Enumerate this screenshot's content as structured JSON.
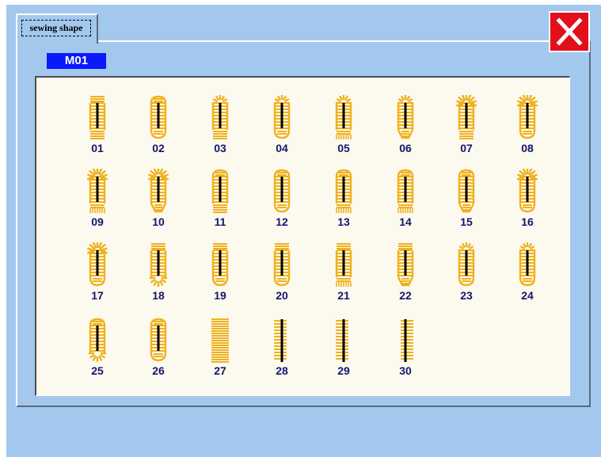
{
  "tab": {
    "label": "sewing shape"
  },
  "mode": {
    "label": "M01"
  },
  "close": {
    "icon": "close-icon",
    "color": "#e3101b"
  },
  "colors": {
    "stitch": "#f0b11c",
    "cut": "#000000",
    "number": "#14166e",
    "badge": "#0b19ff"
  },
  "shapes": [
    {
      "num": "01",
      "top": "square",
      "bottom": "square"
    },
    {
      "num": "02",
      "top": "round",
      "bottom": "round"
    },
    {
      "num": "03",
      "top": "eyelet",
      "bottom": "square"
    },
    {
      "num": "04",
      "top": "eyelet",
      "bottom": "round"
    },
    {
      "num": "05",
      "top": "eyelet",
      "bottom": "bartack"
    },
    {
      "num": "06",
      "top": "eyelet",
      "bottom": "taper"
    },
    {
      "num": "07",
      "top": "eyelet-big",
      "bottom": "square"
    },
    {
      "num": "08",
      "top": "eyelet-big",
      "bottom": "round"
    },
    {
      "num": "09",
      "top": "eyelet-big",
      "bottom": "bartack"
    },
    {
      "num": "10",
      "top": "eyelet-big",
      "bottom": "taper"
    },
    {
      "num": "11",
      "top": "round",
      "bottom": "square"
    },
    {
      "num": "12",
      "top": "round",
      "bottom": "round"
    },
    {
      "num": "13",
      "top": "round",
      "bottom": "bartack"
    },
    {
      "num": "14",
      "top": "round",
      "bottom": "bartack"
    },
    {
      "num": "15",
      "top": "round",
      "bottom": "taper"
    },
    {
      "num": "16",
      "top": "eyelet-big",
      "bottom": "round"
    },
    {
      "num": "17",
      "top": "eyelet-big",
      "bottom": "round"
    },
    {
      "num": "18",
      "top": "square",
      "bottom": "eyelet"
    },
    {
      "num": "19",
      "top": "square",
      "bottom": "round"
    },
    {
      "num": "20",
      "top": "square",
      "bottom": "round"
    },
    {
      "num": "21",
      "top": "square",
      "bottom": "bartack"
    },
    {
      "num": "22",
      "top": "square",
      "bottom": "taper"
    },
    {
      "num": "23",
      "top": "eyelet",
      "bottom": "round"
    },
    {
      "num": "24",
      "top": "eyelet",
      "bottom": "round"
    },
    {
      "num": "25",
      "top": "round",
      "bottom": "eyelet"
    },
    {
      "num": "26",
      "top": "round",
      "bottom": "round"
    },
    {
      "num": "27",
      "top": "block",
      "bottom": "block"
    },
    {
      "num": "28",
      "top": "straight",
      "bottom": "straight"
    },
    {
      "num": "29",
      "top": "straight",
      "bottom": "straight"
    },
    {
      "num": "30",
      "top": "straight-both",
      "bottom": "straight-both"
    }
  ]
}
